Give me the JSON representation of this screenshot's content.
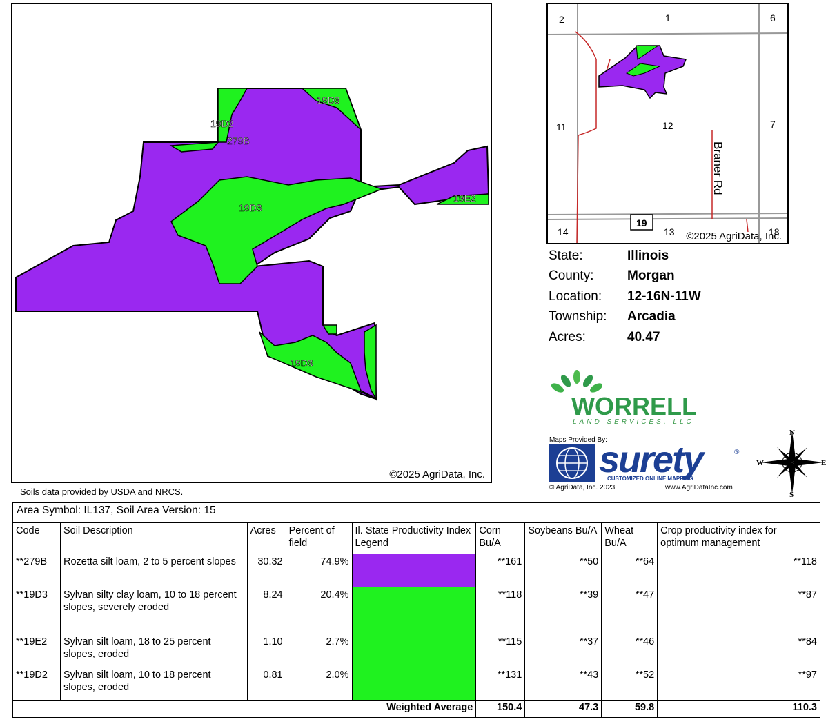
{
  "soil_map": {
    "copyright": "©2025 AgriData, Inc.",
    "labels": [
      "19D3",
      "19D2",
      "279B",
      "19D3",
      "19E2",
      "19D3"
    ]
  },
  "soils_credit": "Soils data provided by USDA and NRCS.",
  "locator": {
    "sections": [
      "2",
      "1",
      "6",
      "11",
      "12",
      "7",
      "14",
      "13",
      "18"
    ],
    "route": "19",
    "road_name": "Braner Rd",
    "copyright": "©2025 AgriData, Inc."
  },
  "info": [
    {
      "key": "State:",
      "value": "Illinois"
    },
    {
      "key": "County:",
      "value": "Morgan"
    },
    {
      "key": "Location:",
      "value": "12-16N-11W"
    },
    {
      "key": "Township:",
      "value": "Arcadia"
    },
    {
      "key": "Acres:",
      "value": "40.47"
    }
  ],
  "logos": {
    "worrell_name": "WORRELL",
    "worrell_sub": "LAND SERVICES, LLC",
    "maps_provided": "Maps Provided By:",
    "surety_word": "surety",
    "surety_reg": "®",
    "surety_tagline": "CUSTOMIZED ONLINE MAPPING",
    "surety_copyright": "© AgriData, Inc. 2023",
    "surety_url": "www.AgriDataInc.com"
  },
  "compass": {
    "n": "N",
    "s": "S",
    "e": "E",
    "w": "W"
  },
  "colors": {
    "purple": "#9a28f0",
    "green": "#1ff21f"
  },
  "table": {
    "area_symbol": "Area Symbol: IL137, Soil Area Version: 15",
    "headers": [
      "Code",
      "Soil Description",
      "Acres",
      "Percent of field",
      "Il. State Productivity Index Legend",
      "Corn Bu/A",
      "Soybeans Bu/A",
      "Wheat Bu/A",
      "Crop productivity index for optimum management"
    ],
    "rows": [
      {
        "code": "**279B",
        "desc": "Rozetta silt loam, 2 to 5 percent slopes",
        "acres": "30.32",
        "pct": "74.9%",
        "color": "#9a28f0",
        "corn": "**161",
        "soy": "**50",
        "wheat": "**64",
        "cpi": "**118"
      },
      {
        "code": "**19D3",
        "desc": "Sylvan silty clay loam, 10 to 18 percent slopes, severely eroded",
        "acres": "8.24",
        "pct": "20.4%",
        "color": "#1ff21f",
        "corn": "**118",
        "soy": "**39",
        "wheat": "**47",
        "cpi": "**87"
      },
      {
        "code": "**19E2",
        "desc": "Sylvan silt loam, 18 to 25 percent slopes, eroded",
        "acres": "1.10",
        "pct": "2.7%",
        "color": "#1ff21f",
        "corn": "**115",
        "soy": "**37",
        "wheat": "**46",
        "cpi": "**84"
      },
      {
        "code": "**19D2",
        "desc": "Sylvan silt loam, 10 to 18 percent slopes, eroded",
        "acres": "0.81",
        "pct": "2.0%",
        "color": "#1ff21f",
        "corn": "**131",
        "soy": "**43",
        "wheat": "**52",
        "cpi": "**97"
      }
    ],
    "weighted": {
      "label": "Weighted Average",
      "corn": "150.4",
      "soy": "47.3",
      "wheat": "59.8",
      "cpi": "110.3"
    }
  }
}
